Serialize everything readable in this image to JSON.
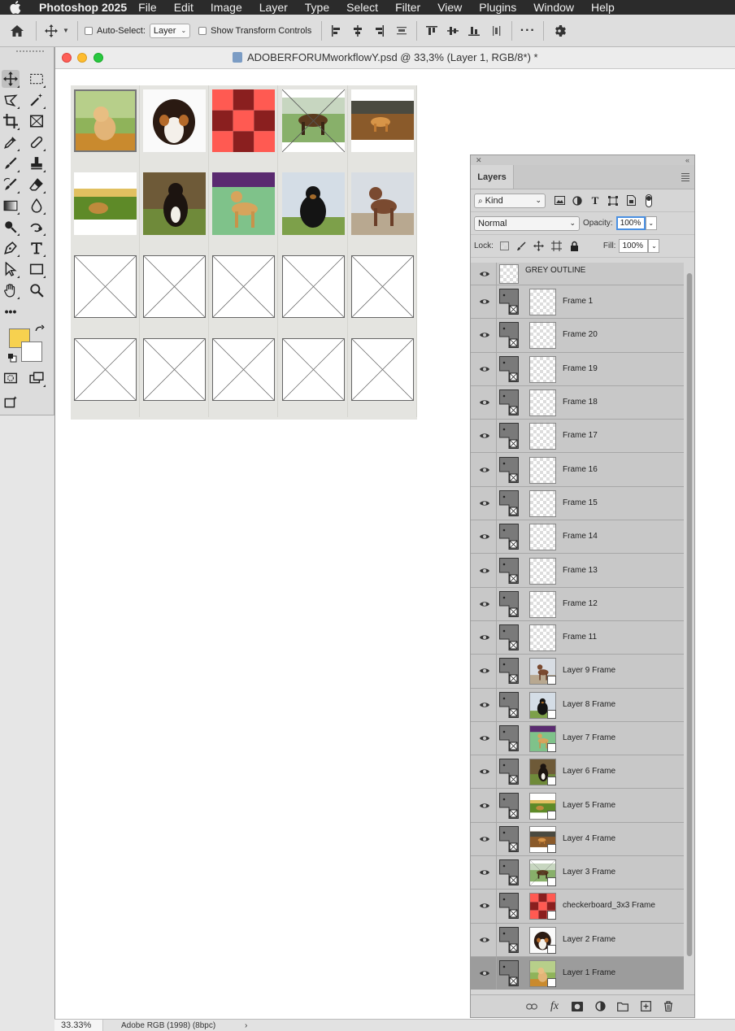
{
  "menubar": {
    "app_name": "Photoshop 2025",
    "items": [
      "File",
      "Edit",
      "Image",
      "Layer",
      "Type",
      "Select",
      "Filter",
      "View",
      "Plugins",
      "Window",
      "Help"
    ]
  },
  "options_bar": {
    "auto_select_label": "Auto-Select:",
    "auto_select_value": "Layer",
    "show_transform_label": "Show Transform Controls"
  },
  "document": {
    "title": "ADOBERFORUMworkflowY.psd @ 33,3% (Layer 1, RGB/8*) *"
  },
  "status_bar": {
    "zoom": "33.33%",
    "doc_info": "Adobe RGB (1998) (8bpc)",
    "arrow": "›"
  },
  "colors": {
    "foreground": "#f7d14f",
    "background": "#ffffff",
    "checkerboard_a": "#ff5a52",
    "checkerboard_b": "#8a1f1f"
  },
  "layers_panel": {
    "tab": "Layers",
    "filter_kind": "Kind",
    "blend_mode": "Normal",
    "opacity_label": "Opacity:",
    "opacity_value": "100%",
    "lock_label": "Lock:",
    "fill_label": "Fill:",
    "fill_value": "100%",
    "layers": [
      {
        "name": "GREY OUTLINE",
        "thumb": "checker"
      },
      {
        "name": "Frame 1",
        "thumb": "checker"
      },
      {
        "name": "Frame 20",
        "thumb": "checker"
      },
      {
        "name": "Frame 19",
        "thumb": "checker"
      },
      {
        "name": "Frame 18",
        "thumb": "checker"
      },
      {
        "name": "Frame 17",
        "thumb": "checker"
      },
      {
        "name": "Frame 16",
        "thumb": "checker"
      },
      {
        "name": "Frame 15",
        "thumb": "checker"
      },
      {
        "name": "Frame 14",
        "thumb": "checker"
      },
      {
        "name": "Frame 13",
        "thumb": "checker"
      },
      {
        "name": "Frame 12",
        "thumb": "checker"
      },
      {
        "name": "Frame 11",
        "thumb": "checker"
      },
      {
        "name": "Layer 9 Frame",
        "thumb": "dog-brown-standing"
      },
      {
        "name": "Layer 8 Frame",
        "thumb": "dog-black-sitting"
      },
      {
        "name": "Layer 7 Frame",
        "thumb": "dog-tan-show"
      },
      {
        "name": "Layer 6 Frame",
        "thumb": "dog-bernese"
      },
      {
        "name": "Layer 5 Frame",
        "thumb": "puppy-grass-sunset"
      },
      {
        "name": "Layer 4 Frame",
        "thumb": "dog-running-field"
      },
      {
        "name": "Layer 3 Frame",
        "thumb": "german-shepherd"
      },
      {
        "name": "checkerboard_3x3 Frame",
        "thumb": "checkerboard"
      },
      {
        "name": "Layer 2 Frame",
        "thumb": "puppy-tricolor"
      },
      {
        "name": "Layer 1 Frame",
        "thumb": "golden-puppy",
        "selected": true
      }
    ]
  },
  "canvas": {
    "cells": [
      "golden-puppy",
      "puppy-tricolor",
      "checkerboard",
      "german-shepherd",
      "dog-running-field",
      "puppy-grass-sunset",
      "dog-bernese",
      "dog-tan-show",
      "dog-black-sitting",
      "dog-brown-standing",
      "empty-frame",
      "empty-frame",
      "empty-frame",
      "empty-frame",
      "empty-frame",
      "empty-frame",
      "empty-frame",
      "empty-frame",
      "empty-frame",
      "empty-frame"
    ]
  }
}
